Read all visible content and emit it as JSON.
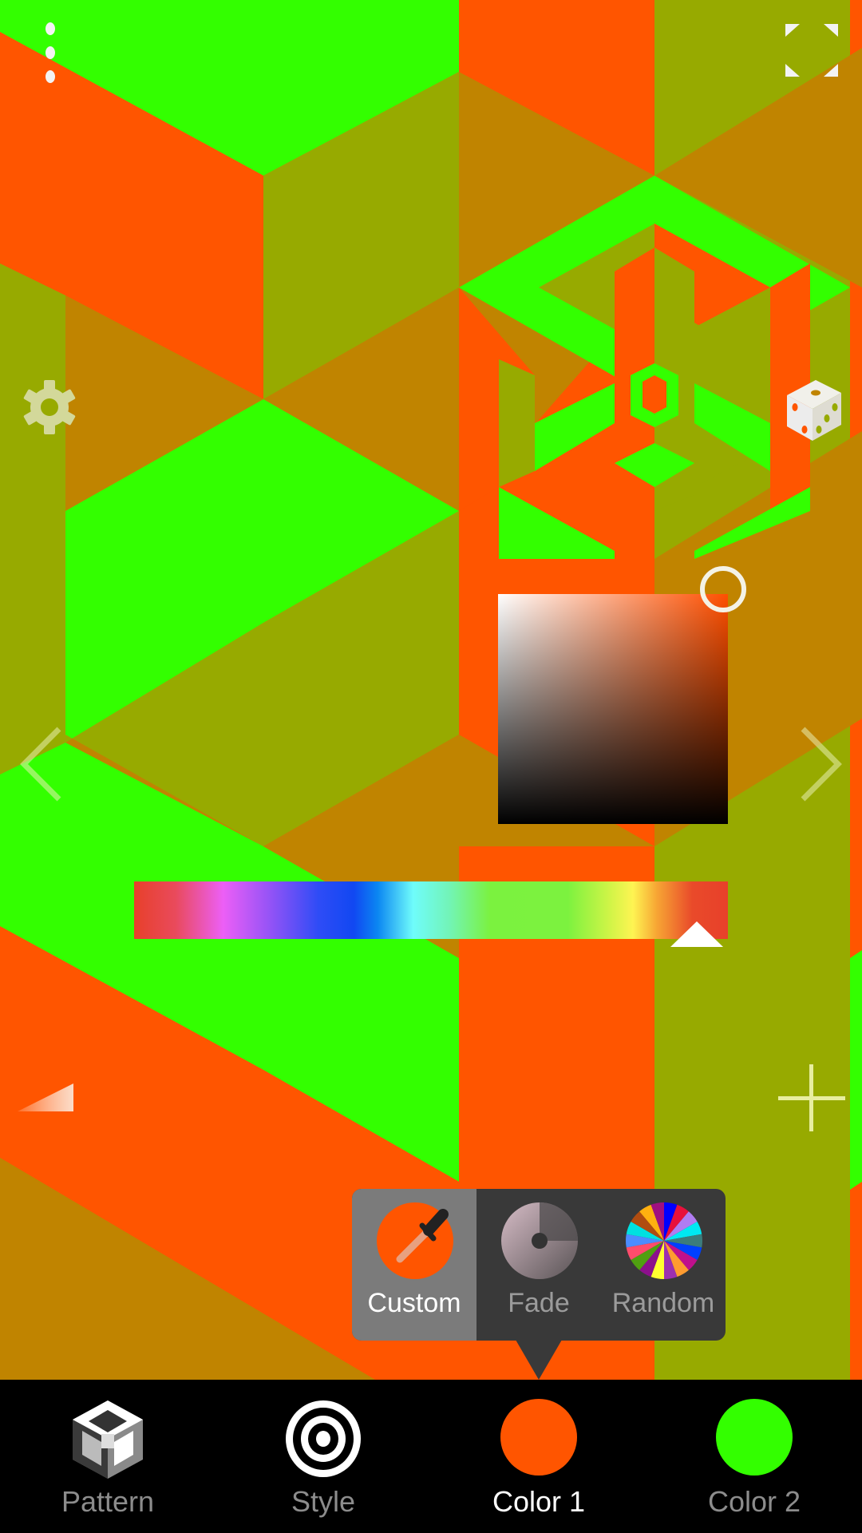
{
  "app": {
    "background_colors": {
      "color1": "#ff5500",
      "color2": "#33ff00",
      "mix_olive": "#97aa00",
      "mix_ochre": "#c08400"
    }
  },
  "top_controls": {
    "menu_icon": "more-vertical-icon",
    "fullscreen_icon": "fullscreen-icon"
  },
  "side_controls": {
    "settings_icon": "gear-icon",
    "randomize_icon": "dice-icon",
    "prev_icon": "chevron-left-icon",
    "next_icon": "chevron-right-icon",
    "ramp_icon": "ramp-triangle-icon",
    "add_icon": "plus-icon"
  },
  "color_picker": {
    "hue_color": "#ff4f00",
    "saturation": 1.0,
    "value": 1.0,
    "hue_position": 0.95
  },
  "color_mode_popover": {
    "selected": "Custom",
    "options": [
      {
        "label": "Custom",
        "icon": "eyedropper-icon"
      },
      {
        "label": "Fade",
        "icon": "fade-dial-icon"
      },
      {
        "label": "Random",
        "icon": "color-wheel-icon"
      }
    ]
  },
  "bottom_nav": {
    "active": "Color 1",
    "tabs": [
      {
        "label": "Pattern",
        "icon": "pattern-cube-icon"
      },
      {
        "label": "Style",
        "icon": "target-rings-icon"
      },
      {
        "label": "Color 1",
        "swatch": "#ff5500"
      },
      {
        "label": "Color 2",
        "swatch": "#33ff00"
      }
    ]
  }
}
